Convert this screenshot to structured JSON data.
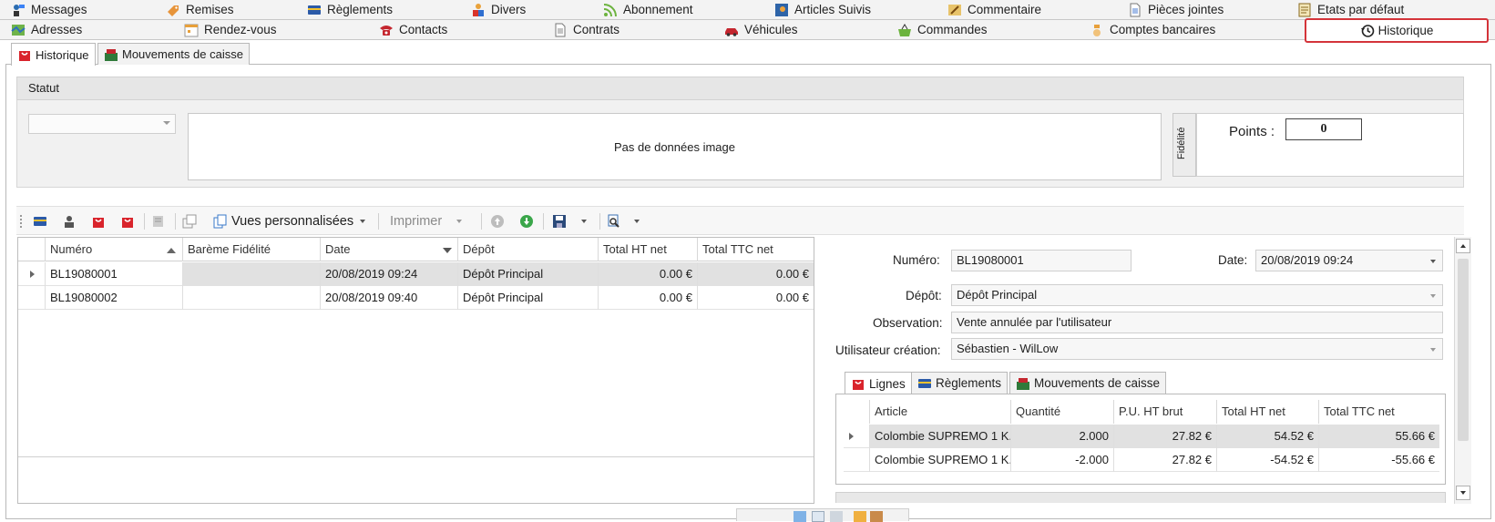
{
  "top_tabs_row1": [
    {
      "label": "Messages",
      "icon": "messages-icon"
    },
    {
      "label": "Remises",
      "icon": "remises-icon"
    },
    {
      "label": "Règlements",
      "icon": "card-icon"
    },
    {
      "label": "Divers",
      "icon": "divers-icon"
    },
    {
      "label": "Abonnement",
      "icon": "rss-icon"
    },
    {
      "label": "Articles Suivis",
      "icon": "articles-suivis-icon"
    },
    {
      "label": "Commentaire",
      "icon": "comment-icon"
    },
    {
      "label": "Pièces jointes",
      "icon": "document-icon"
    },
    {
      "label": "Etats par défaut",
      "icon": "report-icon"
    }
  ],
  "top_tabs_row2": [
    {
      "label": "Adresses",
      "icon": "map-icon"
    },
    {
      "label": "Rendez-vous",
      "icon": "calendar-icon"
    },
    {
      "label": "Contacts",
      "icon": "phone-icon"
    },
    {
      "label": "Contrats",
      "icon": "document-icon"
    },
    {
      "label": "Véhicules",
      "icon": "car-icon"
    },
    {
      "label": "Commandes",
      "icon": "basket-icon"
    },
    {
      "label": "Comptes bancaires",
      "icon": "bank-icon"
    },
    {
      "label": "Historique",
      "icon": "history-icon",
      "active": true
    }
  ],
  "sub_tabs": [
    {
      "label": "Historique",
      "icon": "bag-icon",
      "active": true
    },
    {
      "label": "Mouvements de caisse",
      "icon": "cash-register-icon"
    }
  ],
  "statut": {
    "header": "Statut",
    "image_placeholder": "Pas de données image",
    "fidelite_label": "Fidélité",
    "points_label": "Points :",
    "points_value": "0"
  },
  "toolbar": {
    "vues": "Vues personnalisées",
    "imprimer": "Imprimer"
  },
  "grid": {
    "columns": [
      "Numéro",
      "Barème Fidélité",
      "Date",
      "Dépôt",
      "Total HT net",
      "Total TTC net"
    ],
    "rows": [
      {
        "numero": "BL19080001",
        "bareme": "",
        "date": "20/08/2019 09:24",
        "depot": "Dépôt Principal",
        "ht": "0.00 €",
        "ttc": "0.00 €",
        "selected": true
      },
      {
        "numero": "BL19080002",
        "bareme": "",
        "date": "20/08/2019 09:40",
        "depot": "Dépôt Principal",
        "ht": "0.00 €",
        "ttc": "0.00 €",
        "selected": false
      }
    ]
  },
  "detail": {
    "numero_label": "Numéro:",
    "numero_value": "BL19080001",
    "date_label": "Date:",
    "date_value": "20/08/2019 09:24",
    "depot_label": "Dépôt:",
    "depot_value": "Dépôt Principal",
    "observation_label": "Observation:",
    "observation_value": "Vente annulée par l'utilisateur",
    "utilisateur_label": "Utilisateur création:",
    "utilisateur_value": "Sébastien - WilLow"
  },
  "inner_tabs": [
    {
      "label": "Lignes",
      "icon": "bag-icon",
      "active": true
    },
    {
      "label": "Règlements",
      "icon": "card-icon"
    },
    {
      "label": "Mouvements de caisse",
      "icon": "cash-register-icon"
    }
  ],
  "lines_grid": {
    "columns": [
      "Article",
      "Quantité",
      "P.U. HT brut",
      "Total HT net",
      "Total TTC net"
    ],
    "rows": [
      {
        "article": "Colombie SUPREMO 1 K...",
        "qte": "2.000",
        "pu": "27.82 €",
        "ht": "54.52 €",
        "ttc": "55.66 €",
        "selected": true
      },
      {
        "article": "Colombie SUPREMO 1 K...",
        "qte": "-2.000",
        "pu": "27.82 €",
        "ht": "-54.52 €",
        "ttc": "-55.66 €",
        "selected": false
      }
    ]
  },
  "colors": {
    "highlight_border": "#d4343a",
    "selected_row": "#e1e1e1",
    "panel_bg": "#f1f1f1"
  }
}
